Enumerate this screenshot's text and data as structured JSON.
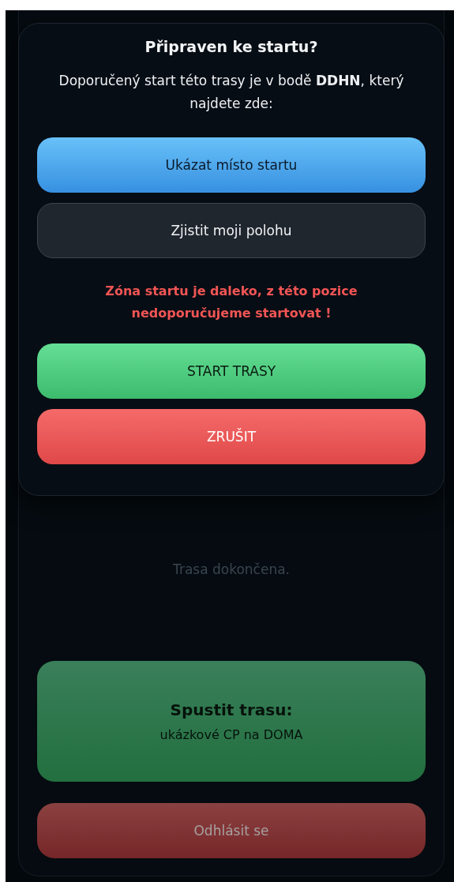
{
  "modal": {
    "title": "Připraven ke startu?",
    "message": "Doporučený start této trasy je v bodě **DDHN**, který najdete zde:",
    "buttons": [
      {
        "label": "Ukázat místo startu",
        "kind": "primary"
      },
      {
        "label": "Zjistit moji polohu",
        "kind": "secondary"
      }
    ],
    "warning": "Zóna startu je daleko, z této pozice nedoporučujeme startovat !",
    "actions": [
      {
        "label": "START TRASY",
        "kind": "confirm"
      },
      {
        "label": "ZRUŠIT",
        "kind": "cancel"
      }
    ]
  },
  "page": {
    "status": "Trasa dokončena.",
    "start_card": {
      "title": "Spustit trasu:",
      "route": "ukázkové CP na DOMA"
    },
    "logout": "Odhlásit se"
  }
}
